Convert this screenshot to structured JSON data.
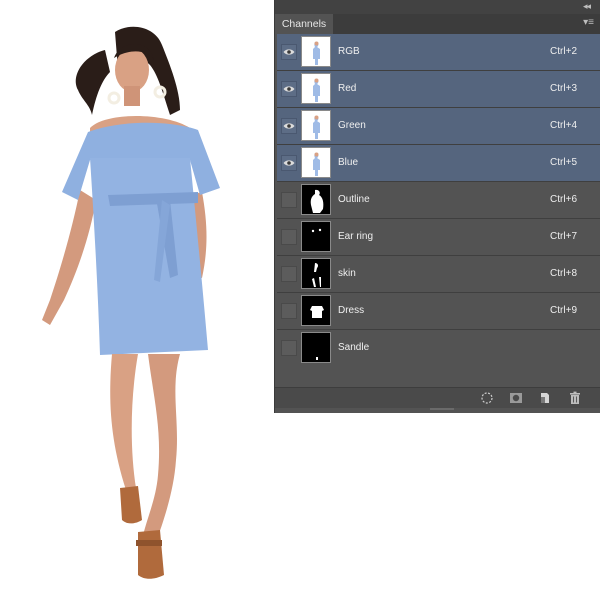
{
  "panel": {
    "tab_label": "Channels",
    "collapse_icon": "double-chevron-right-icon",
    "menu_icon": "panel-menu-icon"
  },
  "channels": [
    {
      "name": "RGB",
      "shortcut": "Ctrl+2",
      "selected": true,
      "visible": true,
      "thumb": "photo"
    },
    {
      "name": "Red",
      "shortcut": "Ctrl+3",
      "selected": true,
      "visible": true,
      "thumb": "photo"
    },
    {
      "name": "Green",
      "shortcut": "Ctrl+4",
      "selected": true,
      "visible": true,
      "thumb": "photo"
    },
    {
      "name": "Blue",
      "shortcut": "Ctrl+5",
      "selected": true,
      "visible": true,
      "thumb": "photo"
    },
    {
      "name": "Outline",
      "shortcut": "Ctrl+6",
      "selected": false,
      "visible": false,
      "thumb": "mask"
    },
    {
      "name": "Ear ring",
      "shortcut": "Ctrl+7",
      "selected": false,
      "visible": false,
      "thumb": "mask"
    },
    {
      "name": "skin",
      "shortcut": "Ctrl+8",
      "selected": false,
      "visible": false,
      "thumb": "mask"
    },
    {
      "name": "Dress",
      "shortcut": "Ctrl+9",
      "selected": false,
      "visible": false,
      "thumb": "mask"
    },
    {
      "name": "Sandle",
      "shortcut": "",
      "selected": false,
      "visible": false,
      "thumb": "mask"
    }
  ],
  "bottom_tools": [
    "load-selection-icon",
    "save-selection-icon",
    "new-channel-icon",
    "delete-channel-icon"
  ],
  "colors": {
    "panel_bg": "#535353",
    "selected_row": "#55657e",
    "dress_blue": "#8fb0e0"
  }
}
